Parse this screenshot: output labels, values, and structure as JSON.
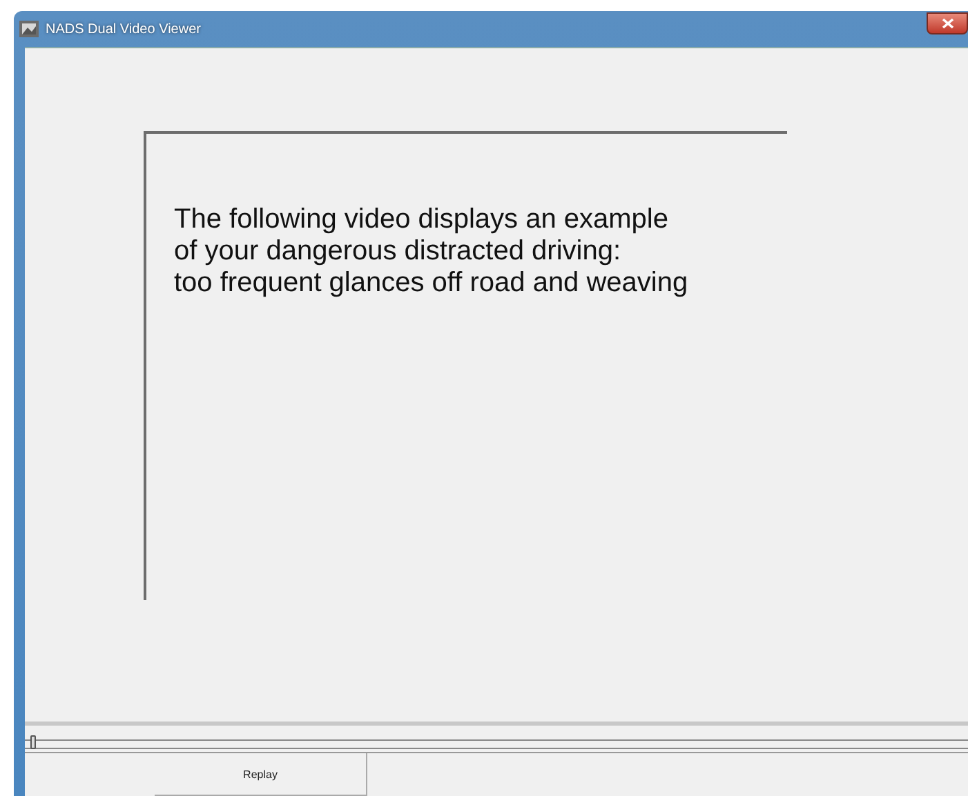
{
  "window": {
    "title": "NADS Dual Video Viewer"
  },
  "message": [
    "The following video displays an example",
    "of your dangerous distracted driving:",
    "too frequent glances off road and weaving"
  ],
  "slider": {
    "level": 0
  },
  "buttons": [
    "Replay"
  ]
}
